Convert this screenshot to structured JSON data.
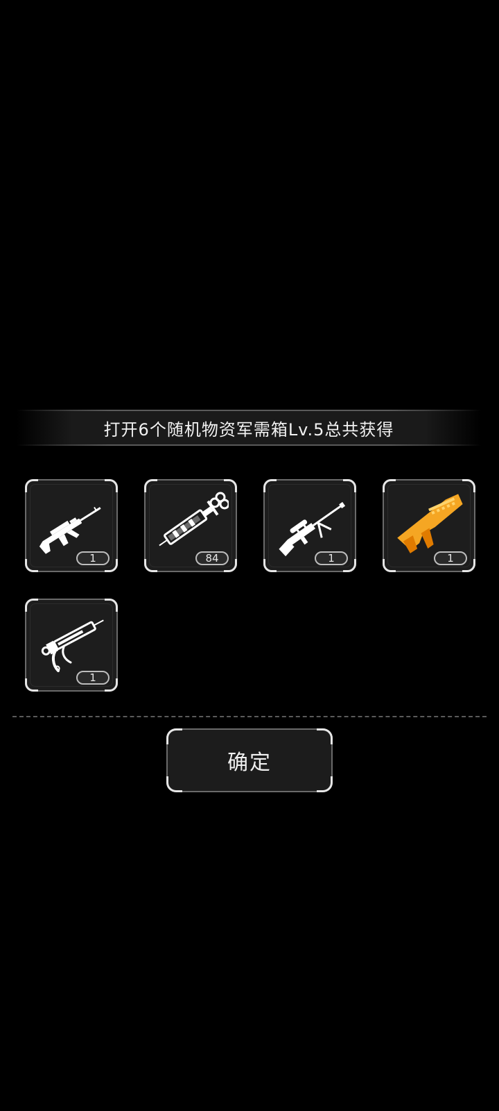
{
  "header": {
    "title": "打开6个随机物资军需箱Lv.5总共获得"
  },
  "rewards": [
    {
      "icon": "assault-rifle-icon",
      "quantity": "1",
      "color": "#ffffff"
    },
    {
      "icon": "syringe-icon",
      "quantity": "84",
      "color": "#ffffff"
    },
    {
      "icon": "sniper-rifle-icon",
      "quantity": "1",
      "color": "#ffffff"
    },
    {
      "icon": "shotgun-icon",
      "quantity": "1",
      "color": "#f5a623"
    },
    {
      "icon": "injector-gun-icon",
      "quantity": "1",
      "color": "#ffffff"
    }
  ],
  "actions": {
    "confirm_label": "确定"
  },
  "colors": {
    "background": "#000000",
    "slot": "#1d1d1d",
    "accent_orange": "#f5a623",
    "text": "#f2f2f2"
  }
}
